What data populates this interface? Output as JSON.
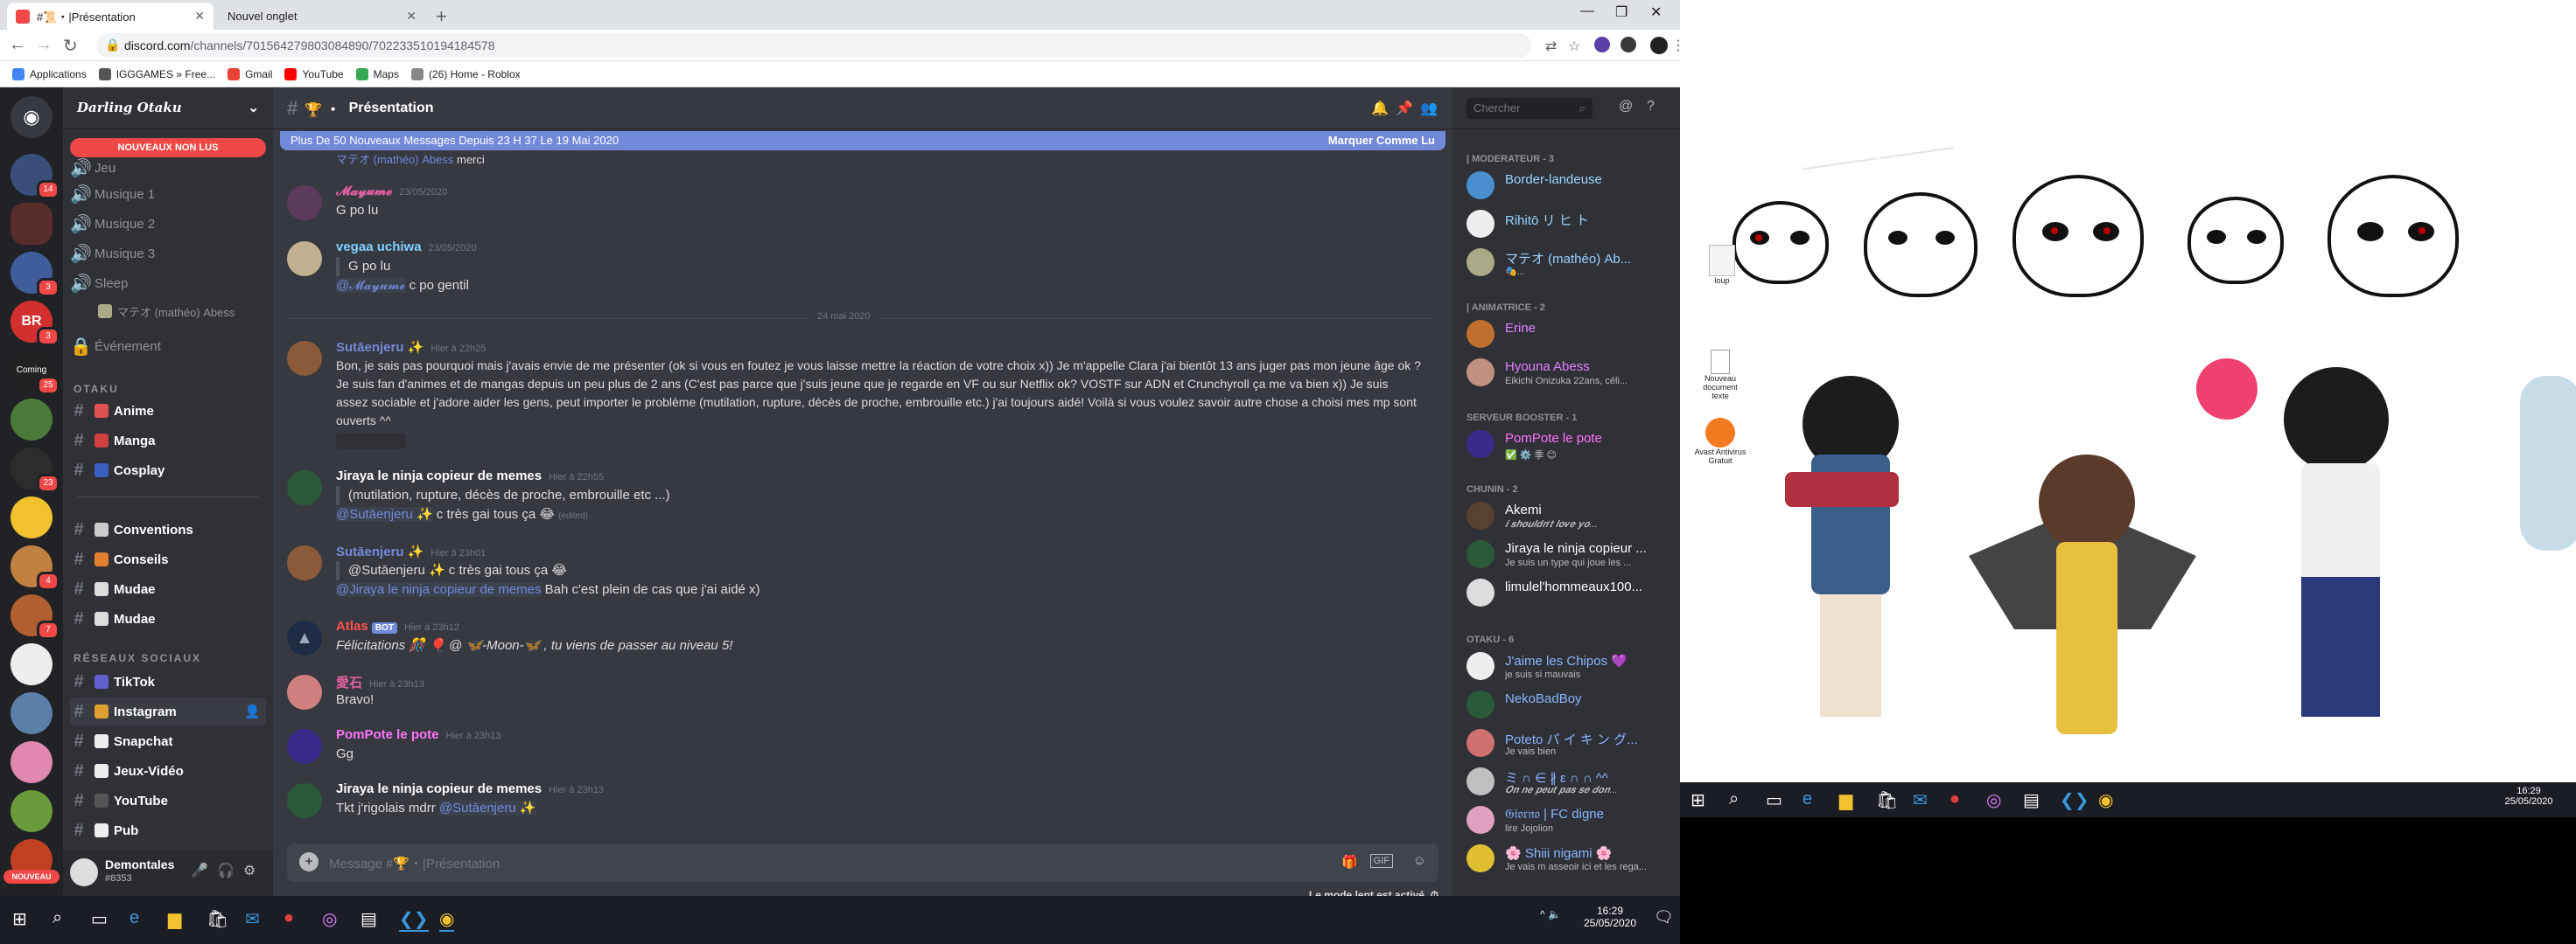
{
  "browser": {
    "tabs": [
      {
        "title": "#📜・|Présentation",
        "active": true
      },
      {
        "title": "Nouvel onglet",
        "active": false
      }
    ],
    "url_host": "discord.com",
    "url_path": "/channels/701564279803084890/702233510194184578",
    "bookmarks": [
      "Applications",
      "IGGGAMES » Free...",
      "Gmail",
      "YouTube",
      "Maps",
      "(26) Home - Roblox"
    ]
  },
  "server": {
    "name": "Darling Otaku",
    "unread_pill": "NOUVEAUX NON LUS",
    "channels_top": [
      {
        "name": "Jeu",
        "type": "voice"
      },
      {
        "name": "Musique 1",
        "type": "voice"
      },
      {
        "name": "Musique 2",
        "type": "voice"
      },
      {
        "name": "Musique 3",
        "type": "voice"
      },
      {
        "name": "Sleep",
        "type": "voice"
      },
      {
        "name": "マテオ (mathéo) Abess",
        "type": "user"
      },
      {
        "name": "Événement",
        "type": "event"
      }
    ],
    "category_otaku": "OTAKU",
    "channels_otaku": [
      "Anime",
      "Manga",
      "Cosplay",
      "Conventions",
      "Conseils",
      "Mudae",
      "Mudae"
    ],
    "category_social": "RÉSEAUX SOCIAUX",
    "channels_social": [
      "TikTok",
      "Instagram",
      "Snapchat",
      "Jeux-Vidéo",
      "YouTube",
      "Pub"
    ],
    "guild_badges": [
      "14",
      "3",
      "3",
      "25",
      "23",
      "4",
      "7",
      "NOUVEAU"
    ]
  },
  "user": {
    "name": "Demontales",
    "tag": "#8353"
  },
  "channel": {
    "name": "Présentation",
    "new_messages": "Plus De 50 Nouveaux Messages Depuis 23 H 37 Le 19 Mai 2020",
    "mark_read": "Marquer Comme Lu",
    "composer_placeholder": "Message #🏆・|Présentation",
    "slow_mode": "Le mode lent est activé.",
    "date_divider": "24 mai 2020"
  },
  "messages": [
    {
      "author": "マテオ (mathéo) Abess",
      "time": "",
      "text": "merci"
    },
    {
      "author": "𝓜𝓪𝔂𝓾𝓶𝓮",
      "time": "23/05/2020",
      "text": "G po lu"
    },
    {
      "author": "vegaa uchiwa",
      "time": "23/05/2020",
      "quote": "G po lu",
      "mention": "@𝓜𝓪𝔂𝓾𝓶𝓮",
      "text": "c po gentil"
    },
    {
      "author": "Sutāenjeru ✨",
      "time": "Hier à 22h25",
      "text": "Bon, je sais pas pourquoi mais j'avais envie de me présenter (ok si vous en foutez je vous laisse mettre la réaction de votre choix x)) Je m'appelle Clara j'ai bientôt 13 ans juger pas mon jeune âge ok ? Je suis fan d'animes et de mangas depuis un peu plus de 2 ans (C'est pas parce que j'suis jeune que je regarde en VF ou sur Netflix ok? VOSTF sur ADN et Crunchyroll ça me va bien x)) Je suis assez sociable et j'adore aider les gens, peut importer le problème (mutilation, rupture, décès de proche, embrouille etc.) j'ai toujours aidé! Voilà si vous voulez savoir autre chose a choisi mes mp sont ouverts ^^"
    },
    {
      "author": "Jiraya le ninja copieur de memes",
      "time": "Hier à 22h55",
      "quote": "(mutilation, rupture, décès de proche, embrouille etc ...)",
      "mention": "@Sutāenjeru ✨",
      "text": "c très gai tous ça 😂",
      "edited": "(edited)"
    },
    {
      "author": "Sutāenjeru ✨",
      "time": "Hier à 23h01",
      "quote": "@Sutāenjeru ✨ c très gai tous ça 😂",
      "mention": "@Jiraya le ninja copieur de memes",
      "text": "Bah c'est plein de cas que j'ai aidé x)"
    },
    {
      "author": "Atlas",
      "bot": "BOT",
      "time": "Hier à 23h12",
      "text": "Félicitations 🎊 🎈 @ 🦋-Moon-🦋 , tu viens de passer au niveau 5!"
    },
    {
      "author": "愛石",
      "time": "Hier à 23h13",
      "text": "Bravo!"
    },
    {
      "author": "PomPote le pote",
      "time": "Hier à 23h13",
      "text": "Gg"
    },
    {
      "author": "Jiraya le ninja copieur de memes",
      "time": "Hier à 23h13",
      "text": "Tkt j'rigolais mdrr",
      "mention": "@Sutāenjeru ✨"
    }
  ],
  "members": {
    "search_placeholder": "Chercher",
    "groups": [
      {
        "title": "| MODERATEUR - 3",
        "list": [
          {
            "name": "Border-landeuse",
            "status": "",
            "color": "#9ad2ff"
          },
          {
            "name": "Rihitō リ ヒ ト",
            "status": "",
            "color": "#9ad2ff"
          },
          {
            "name": "マテオ (mathéo) Ab...",
            "status": "🎭...",
            "color": "#9ad2ff"
          }
        ]
      },
      {
        "title": "| ANIMATRICE - 2",
        "list": [
          {
            "name": "Erine",
            "status": "",
            "color": "#e080ff"
          },
          {
            "name": "Hyouna Abess",
            "status": "Eikichi Onizuka 22ans, céli...",
            "color": "#e080ff"
          }
        ]
      },
      {
        "title": "SERVEUR BOOSTER - 1",
        "list": [
          {
            "name": "PomPote le pote",
            "status": "✅ ⚙️ 季 😊",
            "color": "#ff73fa"
          }
        ]
      },
      {
        "title": "CHUNIN - 2",
        "list": [
          {
            "name": "Akemi",
            "status": "𝒊 𝒔𝒉𝒐𝒖𝒍𝒅𝒏'𝒕 𝒍𝒐𝒗𝒆 𝒚𝒐...",
            "color": "#ffffff"
          },
          {
            "name": "Jiraya le ninja copieur ...",
            "status": "Je suis un type qui joue les ...",
            "color": "#ffffff"
          },
          {
            "name": "limulel'hommeaux100...",
            "status": "",
            "color": "#ffffff"
          }
        ]
      },
      {
        "title": "OTAKU - 6",
        "list": [
          {
            "name": "J'aime les Chipos 💜",
            "status": "je suis si mauvais",
            "color": "#8ab4ff"
          },
          {
            "name": "NekoBadBoy",
            "status": "",
            "color": "#8ab4ff"
          },
          {
            "name": "Poteto パ イ キ ン グ...",
            "status": "Je vais bien",
            "color": "#8ab4ff"
          },
          {
            "name": "ミ ∩ ∈ ∦ ε ∩ ∩ ^^",
            "status": "𝑶𝒏 𝒏𝒆 𝒑𝒆𝒖𝒕 𝒑𝒂𝒔 𝒔𝒆 𝒅𝒐𝒏...",
            "color": "#8ab4ff"
          },
          {
            "name": "𝔊𝔦𝔬𝔯𝔫𝔬 | FC digne",
            "status": "lire Jojolion",
            "color": "#8ab4ff"
          },
          {
            "name": "🌸 Shiii nigami 🌸",
            "status": "Je vais m asseoir ici et les rega...",
            "color": "#8ab4ff"
          }
        ]
      }
    ]
  },
  "taskbar1": {
    "time": "16:29",
    "date": "25/05/2020"
  },
  "taskbar2": {
    "time": "16:29",
    "date": "25/05/2020"
  },
  "desktop_icons": [
    {
      "label": "loup"
    },
    {
      "label": "Nouveau document texte"
    },
    {
      "label": "Avast Antivirus Gratuit"
    }
  ],
  "colors": {
    "accent": "#7289da",
    "red": "#f04747",
    "bg": "#36393f"
  }
}
